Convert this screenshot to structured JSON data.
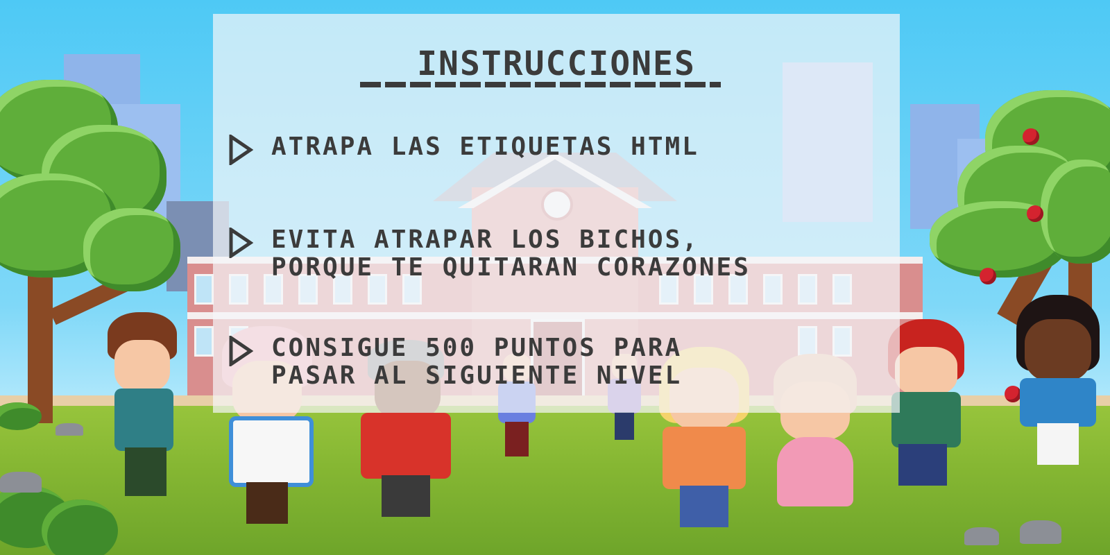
{
  "panel": {
    "title": "INSTRUCCIONES",
    "items": [
      {
        "text": "ATRAPA LAS ETIQUETAS HTML"
      },
      {
        "text": "EVITA ATRAPAR LOS BICHOS,\nPORQUE TE QUITARAN CORAZONES"
      },
      {
        "text": "CONSIGUE 500 PUNTOS PARA\nPASAR AL SIGUIENTE NIVEL"
      }
    ]
  },
  "icons": {
    "bullet": "play-arrow-icon"
  },
  "colors": {
    "sky": "#4ec9f5",
    "grass": "#86b733",
    "panel_bg": "#f5f6fa",
    "text": "#3b3b3b",
    "school_wall": "#d98e8e",
    "apple": "#d4232f"
  }
}
